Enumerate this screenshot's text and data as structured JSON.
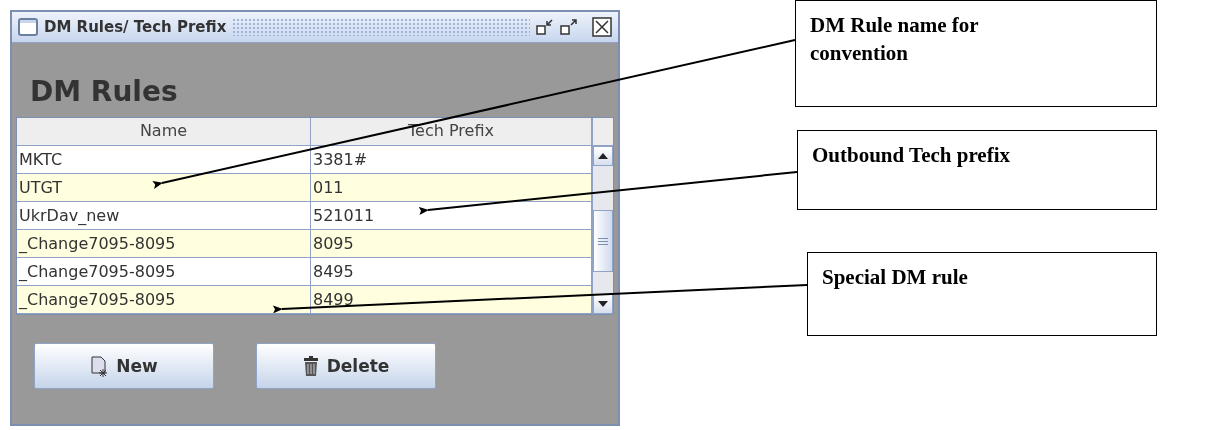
{
  "window": {
    "title": "DM Rules/ Tech Prefix"
  },
  "heading": "DM Rules",
  "table": {
    "columns": [
      "Name",
      "Tech Prefix"
    ],
    "rows": [
      {
        "cells": [
          "MKTC",
          "3381#"
        ]
      },
      {
        "cells": [
          "UTGT",
          "011"
        ]
      },
      {
        "cells": [
          "UkrDav_new",
          "521011"
        ]
      },
      {
        "cells": [
          "_Change7095-8095",
          "8095"
        ]
      },
      {
        "cells": [
          "_Change7095-8095",
          "8495"
        ]
      },
      {
        "cells": [
          "_Change7095-8095",
          "8499"
        ]
      }
    ]
  },
  "buttons": [
    {
      "label": "New",
      "kind": "new"
    },
    {
      "label": "Delete",
      "kind": "delete"
    }
  ],
  "callouts": [
    {
      "text": "DM Rule name for convention"
    },
    {
      "text": "Outbound Tech prefix"
    },
    {
      "text": "Special DM rule"
    }
  ]
}
